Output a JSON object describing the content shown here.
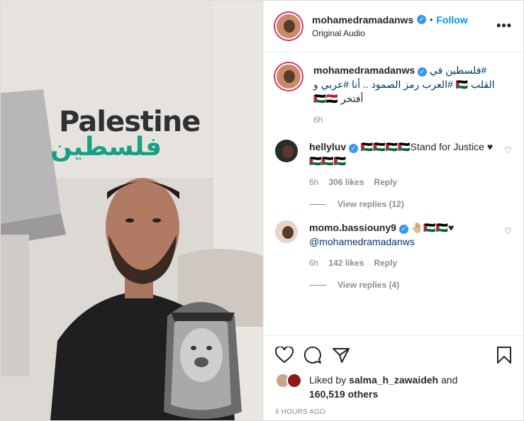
{
  "post": {
    "username": "mohamedramadanws",
    "follow_label": "Follow",
    "subtitle": "Original Audio",
    "more_label": "•••",
    "dot": "•",
    "watermark_en": "Palestine",
    "watermark_ar": "فلسطين"
  },
  "caption": {
    "username": "mohamedramadanws",
    "line1": "فلسطين في#",
    "line2": "العرب رمز الصمود .. أنا #عربي و# 🇵🇸 القلب",
    "line3": "🇵🇸🇪🇬 أفتخر",
    "time": "6h"
  },
  "comments": [
    {
      "username": "hellyluv",
      "text": "🇵🇸🇵🇸🇵🇸🇵🇸Stand for Justice ♥🇵🇸🇵🇸🇵🇸",
      "time": "6h",
      "likes": "306 likes",
      "reply": "Reply",
      "view_replies": "View replies (12)"
    },
    {
      "username": "momo.bassiouny9",
      "text": "🤚🏼🇵🇸🇵🇸♥",
      "mention": "@mohamedramadanws",
      "time": "6h",
      "likes": "142 likes",
      "reply": "Reply",
      "view_replies": "View replies (4)"
    }
  ],
  "likes": {
    "prefix": "Liked by ",
    "by": "salma_h_zawaideh",
    "mid": " and",
    "count": "160,519 others"
  },
  "timestamp": "6 HOURS AGO",
  "icons": [
    "heart-icon",
    "comment-icon",
    "share-icon",
    "bookmark-icon"
  ],
  "colors": {
    "link": "#0095f6",
    "hashtag": "#00376b",
    "muted": "#8e8e8e",
    "watermark_green": "#16a085"
  }
}
